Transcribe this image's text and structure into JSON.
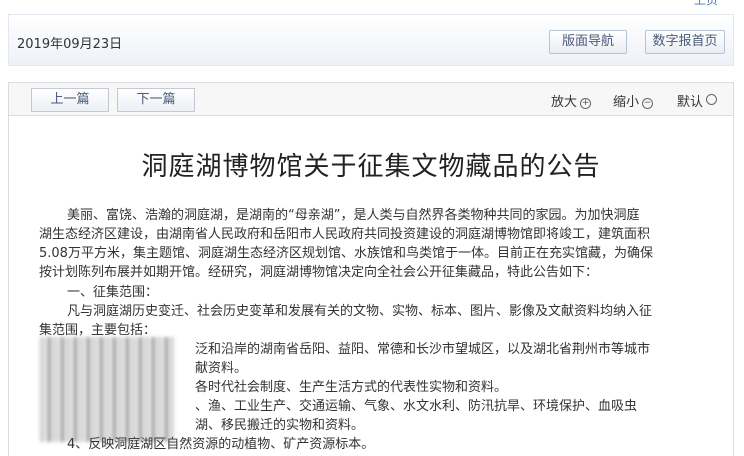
{
  "top_link": "上页",
  "header": {
    "date": "2019年09月23日",
    "layout_nav_label": "版面导航",
    "digital_home_label": "数字报首页"
  },
  "toolbar": {
    "prev_label": "上一篇",
    "next_label": "下一篇",
    "zoom_in_label": "放大",
    "zoom_out_label": "缩小",
    "default_label": "默认"
  },
  "article": {
    "title": "洞庭湖博物馆关于征集文物藏品的公告",
    "lines": [
      "美丽、富饶、浩瀚的洞庭湖，是湖南的“母亲湖”，是人类与自然界各类物种共同的家园。为加快洞庭",
      "湖生态经济区建设，由湖南省人民政府和岳阳市人民政府共同投资建设的洞庭湖博物馆即将竣工，建筑面积",
      "5.08万平方米，集主题馆、洞庭湖生态经济区规划馆、水族馆和鸟类馆于一体。目前正在充实馆藏，为确保",
      "按计划陈列布展并如期开馆。经研究，洞庭湖博物馆决定向全社会公开征集藏品，特此公告如下：",
      "一、征集范围：",
      "凡与洞庭湖历史变迁、社会历史变革和发展有关的文物、实物、标本、图片、影像及文献资料均纳入征",
      "集范围，主要包括：",
      "泛和沿岸的湖南省岳阳、益阳、常德和长沙市望城区，以及湖北省荆州市等城市",
      "献资料。",
      "各时代社会制度、生产生活方式的代表性实物和资料。",
      "、渔、工业生产、交通运输、气象、水文水利、防汛抗旱、环境保护、血吸虫",
      "湖、移民搬迁的实物和资料。",
      "4、反映洞庭湖区自然资源的动植物、矿产资源标本。"
    ]
  }
}
